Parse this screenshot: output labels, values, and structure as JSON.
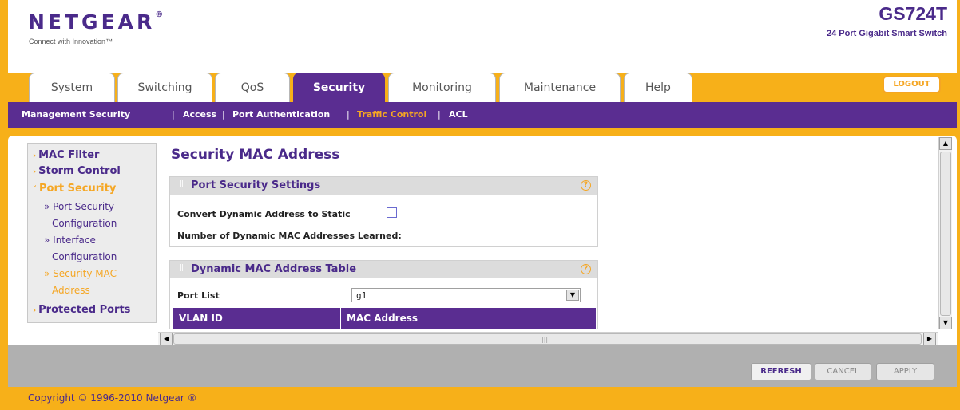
{
  "header": {
    "brand": "NETGEAR",
    "brand_mark": "®",
    "tagline": "Connect with Innovation™",
    "model": "GS724T",
    "model_description": "24 Port Gigabit Smart Switch"
  },
  "tabs": [
    {
      "label": "System"
    },
    {
      "label": "Switching"
    },
    {
      "label": "QoS"
    },
    {
      "label": "Security"
    },
    {
      "label": "Monitoring"
    },
    {
      "label": "Maintenance"
    },
    {
      "label": "Help"
    }
  ],
  "active_tab": "Security",
  "logout_label": "LOGOUT",
  "subnav": {
    "items": [
      {
        "label": "Management Security"
      },
      {
        "label": "Access"
      },
      {
        "label": "Port Authentication"
      },
      {
        "label": "Traffic Control"
      },
      {
        "label": "ACL"
      }
    ],
    "separator": "|",
    "active": "Traffic Control"
  },
  "sidebar": {
    "items": [
      {
        "label": "MAC Filter",
        "bullet": "›"
      },
      {
        "label": "Storm Control",
        "bullet": "›"
      },
      {
        "label": "Port Security",
        "bullet": "˅"
      },
      {
        "label": "Protected Ports",
        "bullet": "›"
      }
    ],
    "subitems": [
      {
        "line1": "» Port Security",
        "line2": "Configuration"
      },
      {
        "line1": "» Interface",
        "line2": "Configuration"
      },
      {
        "line1": "» Security MAC",
        "line2": "Address"
      }
    ]
  },
  "page": {
    "title": "Security MAC Address"
  },
  "port_security_settings": {
    "title": "Port Security Settings",
    "convert_label": "Convert Dynamic Address to Static",
    "convert_checked": false,
    "learned_label": "Number of Dynamic MAC Addresses Learned:",
    "help_icon": "?"
  },
  "dynamic_table": {
    "title": "Dynamic MAC Address Table",
    "port_list_label": "Port List",
    "port_list_value": "g1",
    "columns": [
      "VLAN ID",
      "MAC Address"
    ],
    "help_icon": "?"
  },
  "scroll": {
    "up": "▲",
    "down": "▼",
    "left": "◀",
    "right": "▶",
    "grip": "|||"
  },
  "buttons": {
    "refresh": "REFRESH",
    "cancel": "CANCEL",
    "apply": "APPLY"
  },
  "footer": {
    "copyright": "Copyright © 1996-2010 Netgear ®"
  },
  "colors": {
    "frame": "#f7b019",
    "purple": "#5a2d91",
    "accent_orange": "#f5a623"
  }
}
